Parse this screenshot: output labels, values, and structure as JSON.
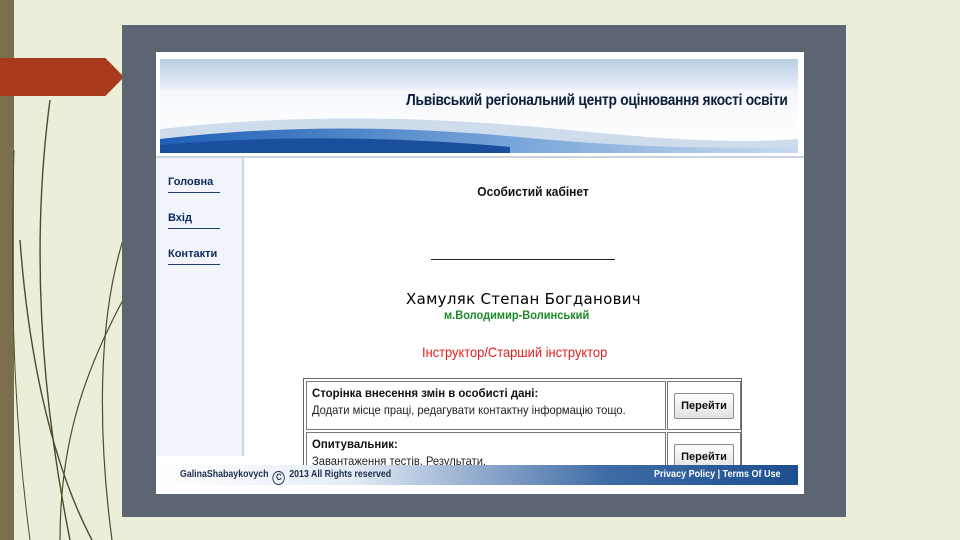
{
  "site": {
    "title": "Львівський регіональний центр оцінювання якості освіти"
  },
  "sidebar": {
    "items": [
      {
        "label": "Головна"
      },
      {
        "label": "Вхід"
      },
      {
        "label": "Контакти"
      }
    ]
  },
  "main": {
    "heading": "Особистий кабінет",
    "person_name": "Хамуляк Степан Богданович",
    "city": "м.Володимир-Волинський",
    "role": "Інструктор/Старший інструктор",
    "actions": [
      {
        "title": "Сторінка внесення змін в особисті дані:",
        "description": "Додати місце праці, редагувати контактну інформацію тощо.",
        "button_label": "Перейти"
      },
      {
        "title": "Опитувальник:",
        "description": "Завантаження тестів. Результати.",
        "button_label": "Перейти"
      }
    ]
  },
  "footer": {
    "author": "GalinaShabaykovych",
    "copyright_symbol": "C",
    "copyright_text": "2013 All Rights reserved",
    "privacy_label": "Privacy Policy",
    "separator": "|",
    "terms_label": "Terms Of Use"
  },
  "colors": {
    "slide_background": "#e9efd9",
    "frame": "#5d6472",
    "accent_red": "#a93a1e",
    "city_green": "#1d8a2a",
    "role_red": "#e02020",
    "banner_blue": "#1d4e8f"
  }
}
